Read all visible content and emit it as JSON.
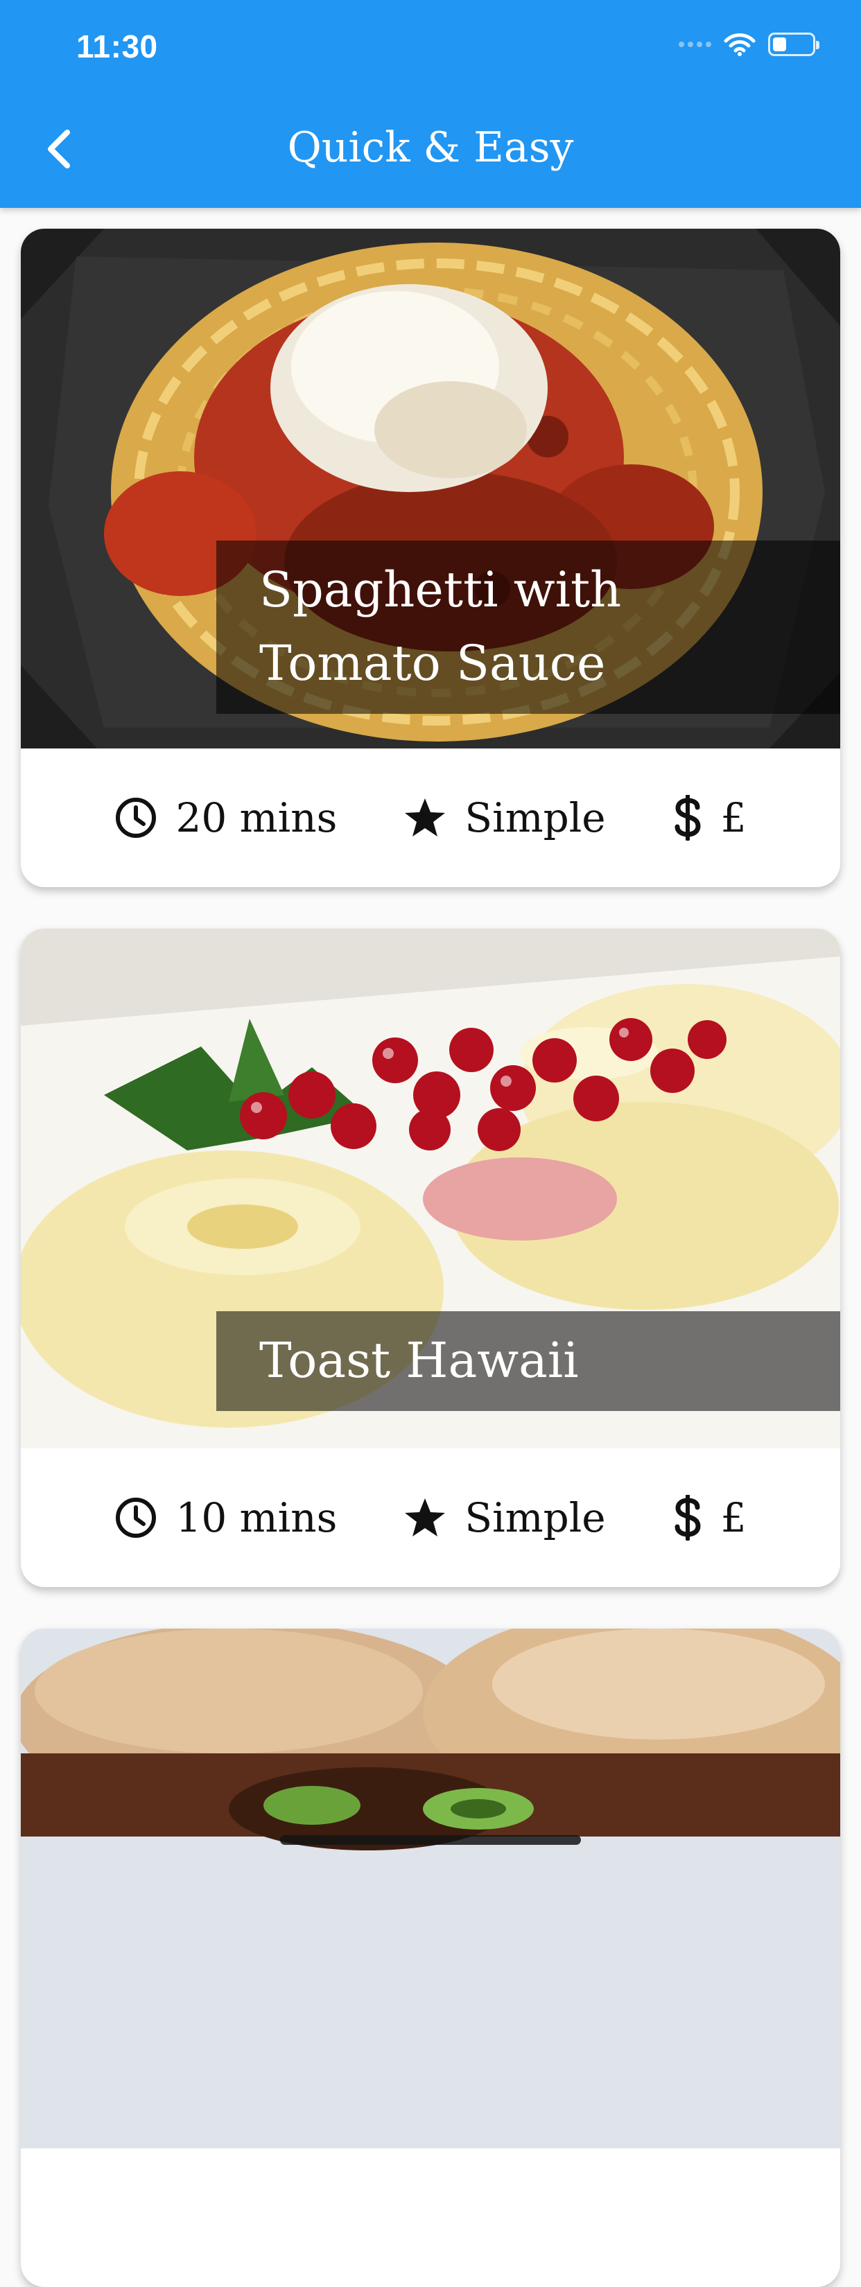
{
  "status_bar": {
    "time": "11:30",
    "battery_level": 0.35
  },
  "app_bar": {
    "title": "Quick & Easy",
    "color": "#2196f3"
  },
  "meals": [
    {
      "title_lines": [
        "Spaghetti with",
        "Tomato Sauce"
      ],
      "duration": "20 mins",
      "complexity": "Simple",
      "affordability": "£",
      "image": "spaghetti-with-tomato-sauce-photo"
    },
    {
      "title_lines": [
        "Toast Hawaii"
      ],
      "duration": "10 mins",
      "complexity": "Simple",
      "affordability": "£",
      "image": "toast-hawaii-photo"
    },
    {
      "title_lines": [],
      "image": "burger-photo"
    }
  ],
  "icons": {
    "back": "chevron-left-icon",
    "duration": "clock-icon",
    "complexity": "star-icon",
    "affordability": "dollar-icon"
  }
}
